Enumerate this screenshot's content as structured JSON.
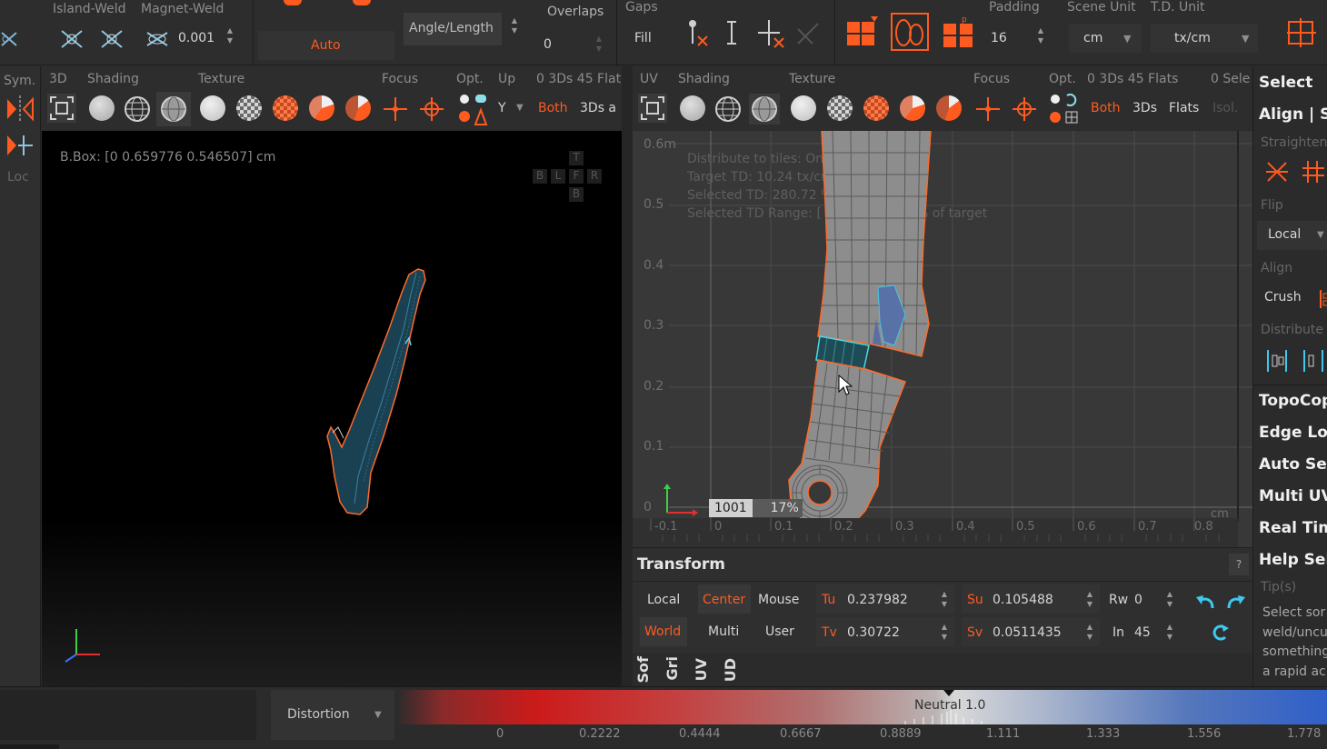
{
  "top_toolbar": {
    "island_weld": "Island-Weld",
    "magnet_weld": "Magnet-Weld",
    "weld_value": "0.001",
    "auto_label": "Auto",
    "angle_length": "Angle/Length",
    "overlaps_label": "Overlaps",
    "overlaps_value": "0",
    "gaps_label": "Gaps",
    "fill_label": "Fill",
    "padding_label": "Padding",
    "padding_value": "16",
    "scene_unit_label": "Scene Unit",
    "scene_unit_value": "cm",
    "td_unit_label": "T.D. Unit",
    "td_unit_value": "tx/cm"
  },
  "left_strip": {
    "sym": "Sym.",
    "loc": "Loc"
  },
  "view3d_bar": {
    "tab_3d": "3D",
    "shading": "Shading",
    "texture": "Texture",
    "focus": "Focus",
    "opt": "Opt.",
    "up": "Up",
    "up_value": "Y",
    "stats": "0 3Ds 45 Flat",
    "both": "Both",
    "threeds": "3Ds a"
  },
  "view3d": {
    "bbox": "B.Box: [0 0.659776 0.546507] cm",
    "cube": {
      "t": "T",
      "b": "B",
      "l": "L",
      "f": "F",
      "r": "R",
      "bottom": "B"
    }
  },
  "uv_bar": {
    "uv": "UV",
    "shading": "Shading",
    "texture": "Texture",
    "focus": "Focus",
    "opt": "Opt.",
    "stats": "0 3Ds 45 Flats",
    "sele": "0 Sele",
    "both": "Both",
    "threeds": "3Ds",
    "flats": "Flats",
    "isol": "Isol."
  },
  "uv_view": {
    "overlay_lines": [
      "Distribute to tiles: On",
      "Target TD: 10.24 tx/cm",
      "Selected TD: 280.72 % of target",
      "Selected TD Range: [ 17.25 - 5.08 ] % of target"
    ],
    "y_ticks": [
      "0.6m",
      "0.5",
      "0.4",
      "0.3",
      "0.2",
      "0.1",
      "0"
    ],
    "x_ticks": [
      "-0.1",
      "0",
      "0.1",
      "0.2",
      "0.3",
      "0.4",
      "0.5",
      "0.6",
      "0.7",
      "0.8"
    ],
    "x_unit": "cm",
    "tile": "1001",
    "tile_pct": "17%"
  },
  "transform": {
    "title": "Transform",
    "help": "?",
    "local": "Local",
    "center": "Center",
    "mouse": "Mouse",
    "world": "World",
    "multi": "Multi",
    "user": "User",
    "tu_label": "Tu",
    "tu_value": "0.237982",
    "tv_label": "Tv",
    "tv_value": "0.30722",
    "su_label": "Su",
    "su_value": "0.105488",
    "sv_label": "Sv",
    "sv_value": "0.0511435",
    "rw_label": "Rw",
    "rw_value": "0",
    "in_label": "In",
    "in_value": "45"
  },
  "side_tabs": [
    "Sof",
    "Gri",
    "UV",
    "UD"
  ],
  "right_panel": {
    "select": "Select",
    "align_st": "Align | St",
    "straighten": "Straighten",
    "flip": "Flip",
    "local": "Local",
    "align": "Align",
    "crush": "Crush",
    "distribute": "Distribute",
    "topocopy": "TopoCop",
    "edge_loop": "Edge Loo",
    "auto_seams": "Auto Sea",
    "multi_uv": "Multi UV",
    "real_time": "Real Tim",
    "help_select": "Help Sele",
    "tips": "Tip(s)",
    "tip_lines": [
      "Select sor",
      "weld/uncu",
      "something",
      "a rapid ac"
    ]
  },
  "bottom": {
    "mode": "Distortion",
    "neutral": "Neutral 1.0",
    "scale": [
      "0",
      "0.2222",
      "0.4444",
      "0.6667",
      "0.8889",
      "1.111",
      "1.333",
      "1.556",
      "1.778"
    ]
  },
  "colors": {
    "accent": "#ff5a1f",
    "background": "#2b2b2b",
    "viewport3d": "#000000",
    "uv_bg": "#383838",
    "mesh_3d": "#1d4b5c",
    "mesh_uv": "#8a8a8a",
    "selected": "#3a8fb0"
  }
}
